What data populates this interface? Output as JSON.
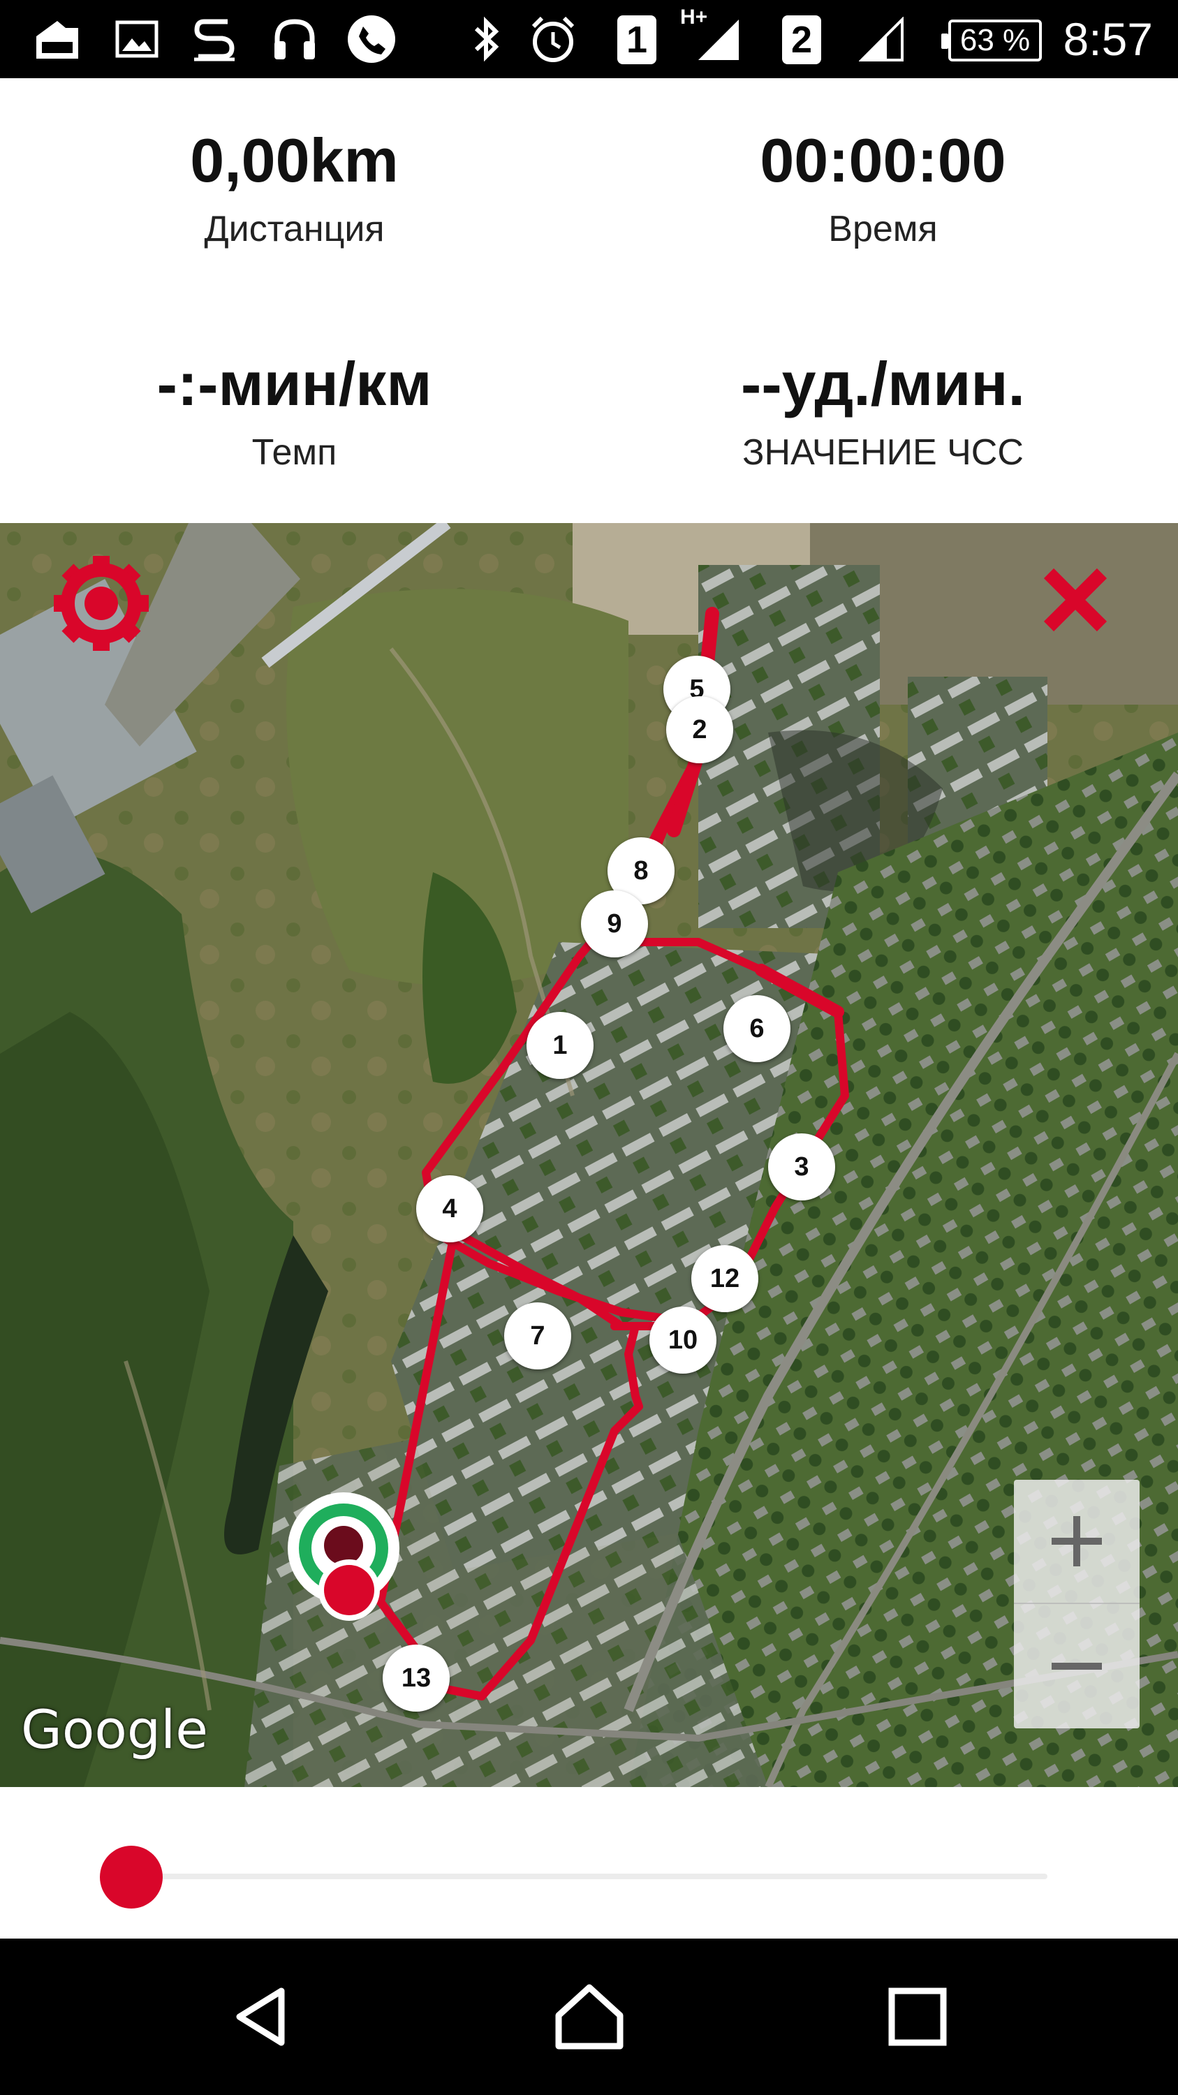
{
  "status_bar": {
    "time": "8:57",
    "battery": "63 %",
    "sim1": "1",
    "sim2": "2",
    "net_type": "H+",
    "icons": [
      "download-icon",
      "gallery-icon",
      "app-s-icon",
      "headphones-icon",
      "phone-icon",
      "bluetooth-icon",
      "alarm-icon",
      "signal-icon",
      "signal-icon"
    ]
  },
  "stats": {
    "distance": {
      "value": "0,00km",
      "label": "Дистанция"
    },
    "time": {
      "value": "00:00:00",
      "label": "Время"
    },
    "pace": {
      "value": "-:-мин/км",
      "label": "Темп"
    },
    "heart_rate": {
      "value": "--уд./мин.",
      "label": "ЗНАЧЕНИЕ ЧСС"
    }
  },
  "map": {
    "provider_logo": "Google",
    "route_color": "#d9062a",
    "markers": [
      "5",
      "2",
      "8",
      "9",
      "1",
      "6",
      "3",
      "4",
      "12",
      "7",
      "10",
      "13"
    ],
    "controls": {
      "settings": "gear-icon",
      "close": "close-icon",
      "zoom_in": "plus-icon",
      "zoom_out": "minus-icon"
    }
  },
  "slider": {
    "position": 0,
    "thumb_color": "#d9062a"
  },
  "nav_bar": {
    "icons": [
      "back-icon",
      "home-icon",
      "recents-icon"
    ]
  }
}
